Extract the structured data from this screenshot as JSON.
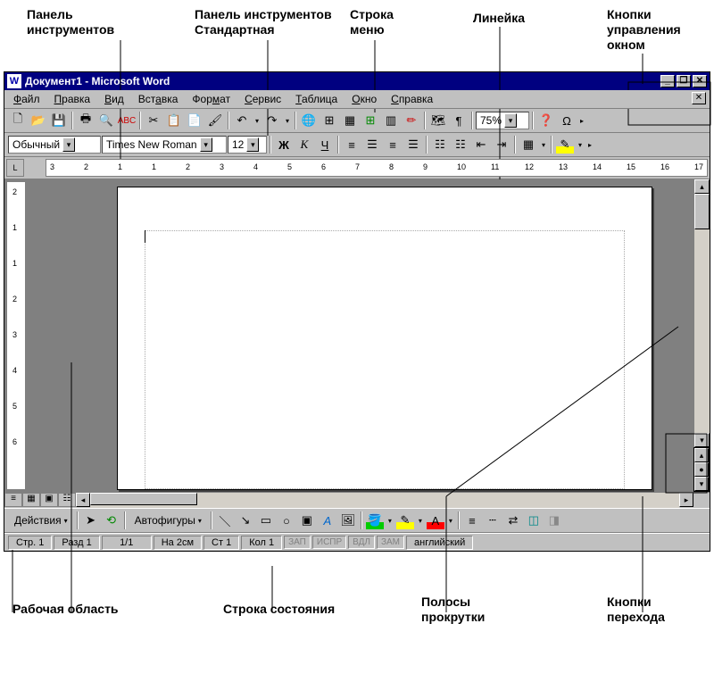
{
  "callouts": {
    "top": {
      "formatting_toolbar": "Панель\nинструментов",
      "standard_toolbar": "Панель инструментов\nСтандартная",
      "menu_bar": "Строка\nменю",
      "ruler": "Линейка",
      "window_buttons": "Кнопки\nуправления\nокном"
    },
    "bottom": {
      "workspace": "Рабочая область",
      "status_bar": "Строка состояния",
      "scrollbars": "Полосы\nпрокрутки",
      "browse_buttons": "Кнопки\nперехода"
    }
  },
  "window": {
    "title": "Документ1 - Microsoft Word",
    "min": "_",
    "max": "❐",
    "close": "✕"
  },
  "menu": {
    "file": "Файл",
    "edit": "Правка",
    "view": "Вид",
    "insert": "Вставка",
    "format": "Формат",
    "tools": "Сервис",
    "table": "Таблица",
    "window": "Окно",
    "help": "Справка"
  },
  "standard_toolbar": {
    "zoom": "75%"
  },
  "formatting_toolbar": {
    "style": "Обычный",
    "font": "Times New Roman",
    "size": "12",
    "bold": "Ж",
    "italic": "К",
    "underline": "Ч"
  },
  "drawing_toolbar": {
    "actions": "Действия",
    "autoshapes": "Автофигуры"
  },
  "status": {
    "page": "Стр. 1",
    "section": "Разд 1",
    "pages": "1/1",
    "at": "На 2см",
    "line": "Ст 1",
    "col": "Кол 1",
    "rec": "ЗАП",
    "trk": "ИСПР",
    "ext": "ВДЛ",
    "ovr": "ЗАМ",
    "lang": "английский"
  },
  "ruler": {
    "numbers": [
      "3",
      "2",
      "1",
      "1",
      "2",
      "3",
      "4",
      "5",
      "6",
      "7",
      "8",
      "9",
      "10",
      "11",
      "12",
      "13",
      "14",
      "15",
      "16",
      "17"
    ]
  },
  "colors": {
    "titlebar": "#000080",
    "ui_face": "#c0c0c0",
    "workspace": "#808080"
  }
}
